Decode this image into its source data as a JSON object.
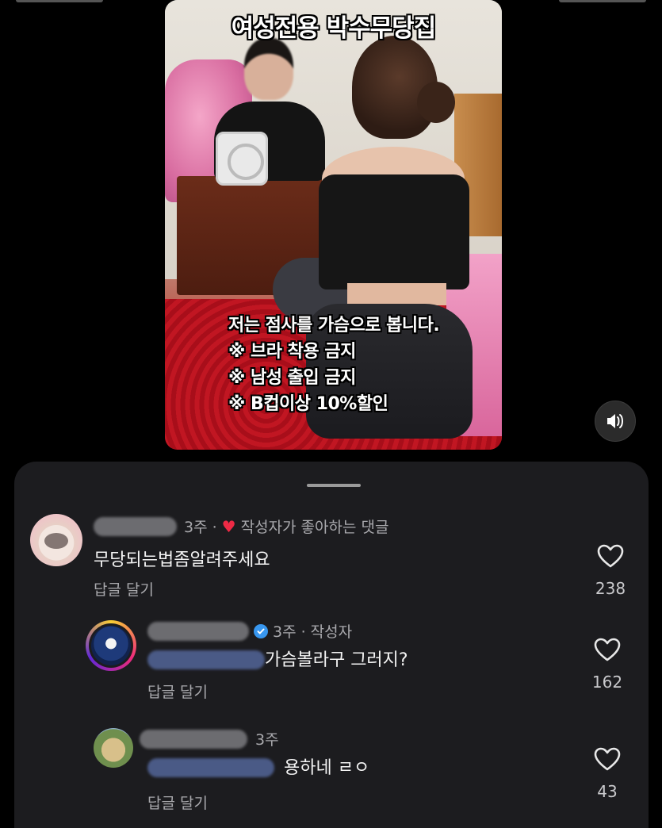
{
  "video": {
    "title": "여성전용 박수무당집",
    "caption_lines": [
      "저는 점사를 가슴으로 봅니다.",
      "※ 브라 착용 금지",
      "※ 남성 출입 금지",
      "※ B컵이상 10%할인"
    ],
    "sound_icon": "speaker-icon"
  },
  "comments": [
    {
      "time": "3주 ·",
      "creator_liked_label": "작성자가 좋아하는 댓글",
      "text": "무당되는법좀알려주세요",
      "reply_label": "답글 달기",
      "likes": "238"
    },
    {
      "time": "3주 · 작성자",
      "text": "가슴볼라구 그러지?",
      "reply_label": "답글 달기",
      "likes": "162"
    },
    {
      "time": "3주",
      "text": "용하네 ㄹㅇ",
      "reply_label": "답글 달기",
      "likes": "43"
    }
  ],
  "colors": {
    "background": "#000000",
    "sheet": "#1c1c1f",
    "heart_red": "#ee2a45",
    "verified_blue": "#3897f0",
    "muted_text": "#a9a9ad"
  }
}
